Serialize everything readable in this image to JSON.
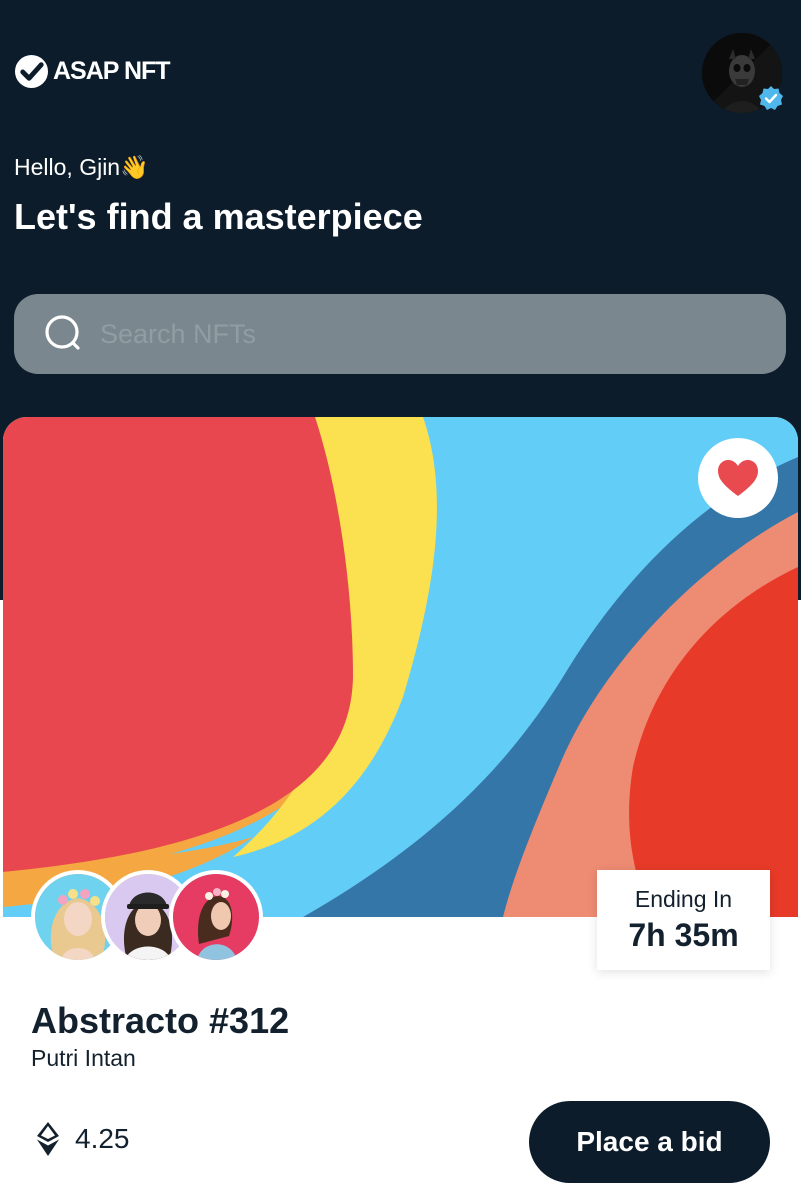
{
  "header": {
    "logo_text": "ASAP NFT",
    "greeting": "Hello, Gjin👋",
    "headline": "Let's find a masterpiece"
  },
  "search": {
    "placeholder": "Search NFTs"
  },
  "card": {
    "title": "Abstracto #312",
    "artist": "Putri Intan",
    "ending_label": "Ending In",
    "ending_time": "7h 35m",
    "price": "4.25",
    "bid_label": "Place a bid"
  },
  "icons": {
    "logo": "check-circle-icon",
    "search": "search-icon",
    "favorite": "heart-icon",
    "verified": "verified-badge-icon",
    "currency": "ethereum-icon"
  },
  "colors": {
    "background": "#0c1c2b",
    "search_bg": "#7a878e",
    "heart": "#e84a4f",
    "verified": "#4fb7ec",
    "art_red": "#e8474f",
    "art_yellow": "#fbe04f",
    "art_sky": "#62cef7",
    "art_blue": "#3576a8",
    "art_salmon": "#ee8b73",
    "art_orange_red": "#e83a28"
  }
}
